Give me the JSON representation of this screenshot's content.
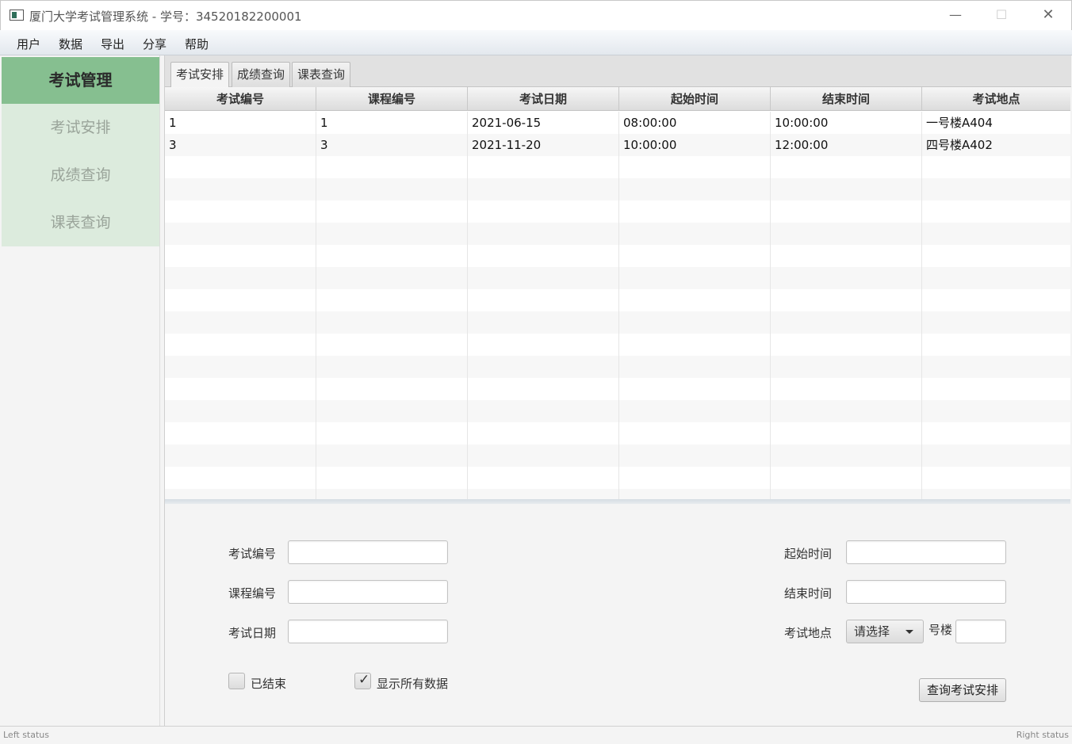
{
  "window": {
    "title": "厦门大学考试管理系统 - 学号：34520182200001",
    "minimize": "—",
    "maximize": "☐",
    "close": "✕"
  },
  "menu": [
    "用户",
    "数据",
    "导出",
    "分享",
    "帮助"
  ],
  "sidebar": {
    "header": "考试管理",
    "items": [
      "考试安排",
      "成绩查询",
      "课表查询"
    ]
  },
  "tabs": [
    "考试安排",
    "成绩查询",
    "课表查询"
  ],
  "table": {
    "columns": [
      "考试编号",
      "课程编号",
      "考试日期",
      "起始时间",
      "结束时间",
      "考试地点"
    ],
    "rows": [
      [
        "1",
        "1",
        "2021-06-15",
        "08:00:00",
        "10:00:00",
        "一号楼A404"
      ],
      [
        "3",
        "3",
        "2021-11-20",
        "10:00:00",
        "12:00:00",
        "四号楼A402"
      ]
    ]
  },
  "form": {
    "exam_id_label": "考试编号",
    "course_id_label": "课程编号",
    "exam_date_label": "考试日期",
    "start_time_label": "起始时间",
    "end_time_label": "结束时间",
    "location_label": "考试地点",
    "location_select": "请选择",
    "building_suffix": "号楼",
    "ended_label": "已结束",
    "ended_checked": false,
    "show_all_label": "显示所有数据",
    "show_all_checked": true,
    "query_button": "查询考试安排"
  },
  "status": {
    "left": "Left status",
    "right": "Right status"
  }
}
